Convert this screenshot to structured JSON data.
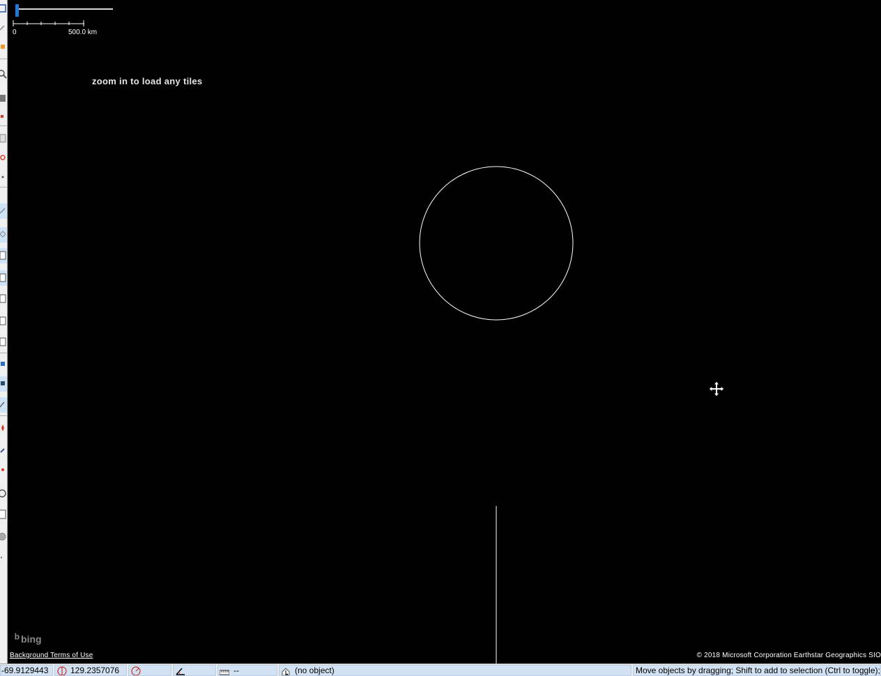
{
  "map": {
    "scale": {
      "zero_label": "0",
      "max_label": "500.0 km"
    },
    "tiles_message": "zoom in to load any tiles",
    "bing_logo": "bing",
    "terms_link": "Background Terms of Use",
    "attribution": "© 2018 Microsoft Corporation Earthstar Geographics SIO"
  },
  "statusbar": {
    "latitude": "-69.9129443",
    "longitude": "129.2357076",
    "heading": "",
    "angle": "",
    "distance": "--",
    "selected_object": "(no object)",
    "help_text": "Move objects by dragging; Shift to add to selection (Ctrl to toggle); Shift-"
  },
  "colors": {
    "map_background": "#000000",
    "zoom_thumb": "#1e7ad6",
    "statusbar_cell": "#d2e2f2",
    "selection_ring": "#ffffff"
  },
  "toolbar": {
    "icons": [
      "select-icon",
      "lasso-icon",
      "draw-icon",
      "zoom-icon",
      "delete-icon",
      "split-icon",
      "combine-icon",
      "merge-icon",
      "parallel-icon",
      "align-icon",
      "image-icon",
      "gpx-icon",
      "street-icon",
      "building-icon",
      "waypoint-icon",
      "measure-icon",
      "circle-icon"
    ]
  }
}
